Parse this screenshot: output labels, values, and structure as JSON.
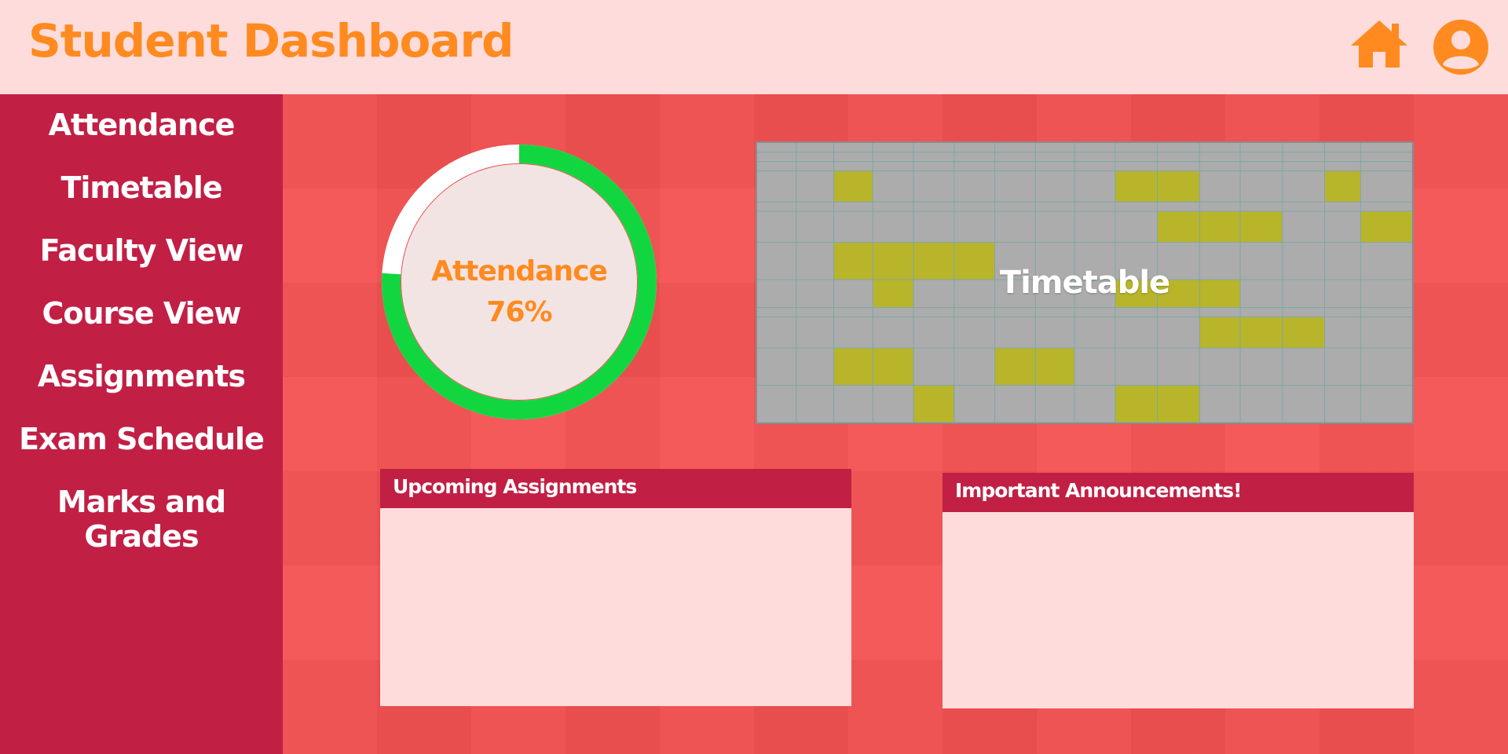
{
  "header": {
    "title": "Student Dashboard",
    "home_icon": "home-icon",
    "profile_icon": "user-profile-icon"
  },
  "sidebar": {
    "items": [
      {
        "label": "Attendance"
      },
      {
        "label": "Timetable"
      },
      {
        "label": "Faculty View"
      },
      {
        "label": "Course View"
      },
      {
        "label": "Assignments"
      },
      {
        "label": "Exam Schedule"
      },
      {
        "label": "Marks and Grades"
      }
    ]
  },
  "attendance": {
    "label": "Attendance",
    "value": "76%",
    "fraction": 0.76
  },
  "timetable": {
    "label": "Timetable"
  },
  "assignments_panel": {
    "title": "Upcoming Assignments"
  },
  "announcements_panel": {
    "title": "Important Announcements!"
  },
  "colors": {
    "brand_orange": "#ff8a1f",
    "sidebar": "#c21f45",
    "header_bg": "#ffdcdc",
    "page_bg": "#f45a5a",
    "ring_green": "#12d63f",
    "ring_track": "#ffffff",
    "highlight_cell": "#b8b52b"
  }
}
